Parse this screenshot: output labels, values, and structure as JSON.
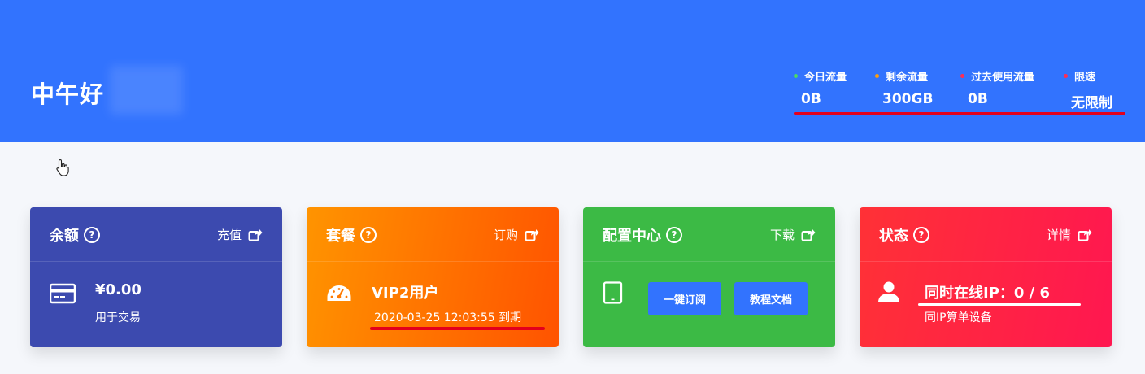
{
  "header": {
    "greeting": "中午好",
    "stats": [
      {
        "label": "今日流量",
        "value": "0B",
        "color": "#4cd964"
      },
      {
        "label": "剩余流量",
        "value": "300GB",
        "color": "#ff9f0a"
      },
      {
        "label": "过去使用流量",
        "value": "0B",
        "color": "#ff2d55"
      },
      {
        "label": "限速",
        "value": "无限制",
        "color": "#ff2d55"
      }
    ]
  },
  "cards": {
    "balance": {
      "title": "余额",
      "link": "充值",
      "main": "¥0.00",
      "sub": "用于交易",
      "icon": "credit-card-icon",
      "color": "#3c4aaf"
    },
    "plan": {
      "title": "套餐",
      "link": "订购",
      "main": "VIP2用户",
      "sub": "2020-03-25 12:03:55 到期",
      "icon": "speedometer-icon",
      "color": "#ff7a00"
    },
    "config": {
      "title": "配置中心",
      "link": "下载",
      "btn1": "一键订阅",
      "btn2": "教程文档",
      "icon": "tablet-icon",
      "color": "#3cba45"
    },
    "status": {
      "title": "状态",
      "link": "详情",
      "main": "同时在线IP：0 / 6",
      "sub": "同IP算单设备",
      "icon": "user-icon",
      "color": "#ff2346"
    }
  },
  "icons": {
    "help": "?",
    "share": "share-icon"
  }
}
